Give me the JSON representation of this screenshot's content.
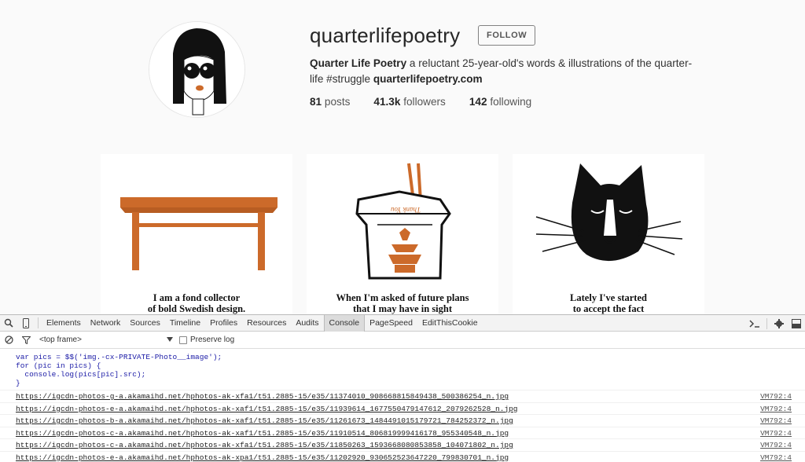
{
  "profile": {
    "username": "quarterlifepoetry",
    "follow_label": "FOLLOW",
    "full_name": "Quarter Life Poetry",
    "bio_text": " a reluctant 25-year-old's words & illustrations of the quarter-life #struggle ",
    "website": "quarterlifepoetry.com",
    "stats": {
      "posts_count": "81",
      "posts_label": " posts",
      "followers_count": "41.3k",
      "followers_label": " followers",
      "following_count": "142",
      "following_label": " following"
    }
  },
  "posts": [
    {
      "caption_line1": "I am a fond collector",
      "caption_line2": "of bold Swedish design."
    },
    {
      "caption_line1": "When I'm asked of future plans",
      "caption_line2": "that I may have in sight",
      "box_text": "Thank You"
    },
    {
      "caption_line1": "Lately I've started",
      "caption_line2": "to accept the fact"
    }
  ],
  "devtools": {
    "tabs": [
      "Elements",
      "Network",
      "Sources",
      "Timeline",
      "Profiles",
      "Resources",
      "Audits",
      "Console",
      "PageSpeed",
      "EditThisCookie"
    ],
    "active_tab": "Console",
    "frame_select": "<top frame>",
    "preserve_log_label": "Preserve log",
    "code_lines": [
      "var pics = $$('img.-cx-PRIVATE-Photo__image');",
      "for (pic in pics) {",
      "  console.log(pics[pic].src);",
      "}"
    ],
    "log_rows": [
      {
        "url": "https://igcdn-photos-g-a.akamaihd.net/hphotos-ak-xfa1/t51.2885-15/e35/11374010_908668815849438_500386254_n.jpg",
        "source": "VM792:4"
      },
      {
        "url": "https://igcdn-photos-e-a.akamaihd.net/hphotos-ak-xaf1/t51.2885-15/e35/11939614_1677550479147612_2079262528_n.jpg",
        "source": "VM792:4"
      },
      {
        "url": "https://igcdn-photos-b-a.akamaihd.net/hphotos-ak-xaf1/t51.2885-15/e35/11261673_1484491015179721_784252372_n.jpg",
        "source": "VM792:4"
      },
      {
        "url": "https://igcdn-photos-c-a.akamaihd.net/hphotos-ak-xaf1/t51.2885-15/e35/11910514_806819999416178_955340548_n.jpg",
        "source": "VM792:4"
      },
      {
        "url": "https://igcdn-photos-c-a.akamaihd.net/hphotos-ak-xfa1/t51.2885-15/e35/11850263_1593668080853858_104071802_n.jpg",
        "source": "VM792:4"
      },
      {
        "url": "https://igcdn-photos-e-a.akamaihd.net/hphotos-ak-xpa1/t51.2885-15/e35/11202920_930652523647220_799830701_n.jpg",
        "source": "VM792:4"
      }
    ]
  },
  "colors": {
    "illustration_orange": "#cc6a2a",
    "devtools_link": "#222222",
    "page_bg": "#fafafa"
  },
  "icons": [
    "search-icon",
    "mobile-device-icon",
    "console-prompt-icon",
    "gear-icon",
    "dock-icon",
    "clear-console-icon",
    "filter-icon",
    "dropdown-arrow-icon"
  ]
}
